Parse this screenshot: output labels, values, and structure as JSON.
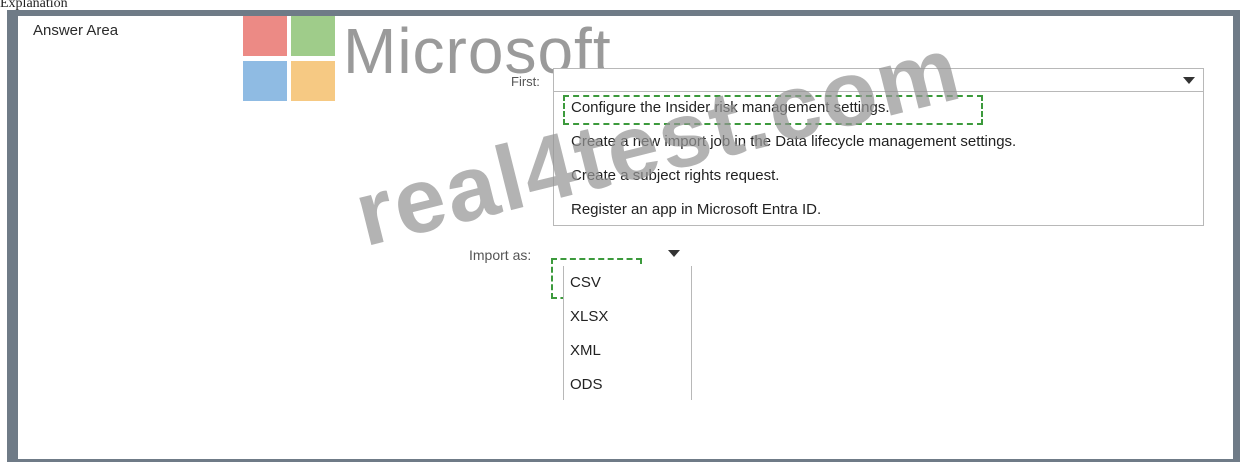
{
  "page": {
    "caption": "Explanation"
  },
  "answer_area": {
    "title": "Answer Area"
  },
  "watermark": {
    "logo_text": "Microsoft",
    "overlay_text": "real4test.com",
    "logo_colors": [
      "#ec8a85",
      "#9fcc8a",
      "#8fbbe3",
      "#f6c983"
    ]
  },
  "first": {
    "label": "First:",
    "selected": "Configure the Insider risk management settings.",
    "options": [
      "Configure the Insider risk management settings.",
      "Create a new import job in the Data lifecycle management settings.",
      "Create a subject rights request.",
      "Register an app in Microsoft Entra ID."
    ]
  },
  "import_as": {
    "label": "Import as:",
    "selected": "CSV",
    "options": [
      "CSV",
      "XLSX",
      "XML",
      "ODS"
    ]
  },
  "colors": {
    "frame": "#6f7b87",
    "selection_dash": "#3c9a3c"
  }
}
